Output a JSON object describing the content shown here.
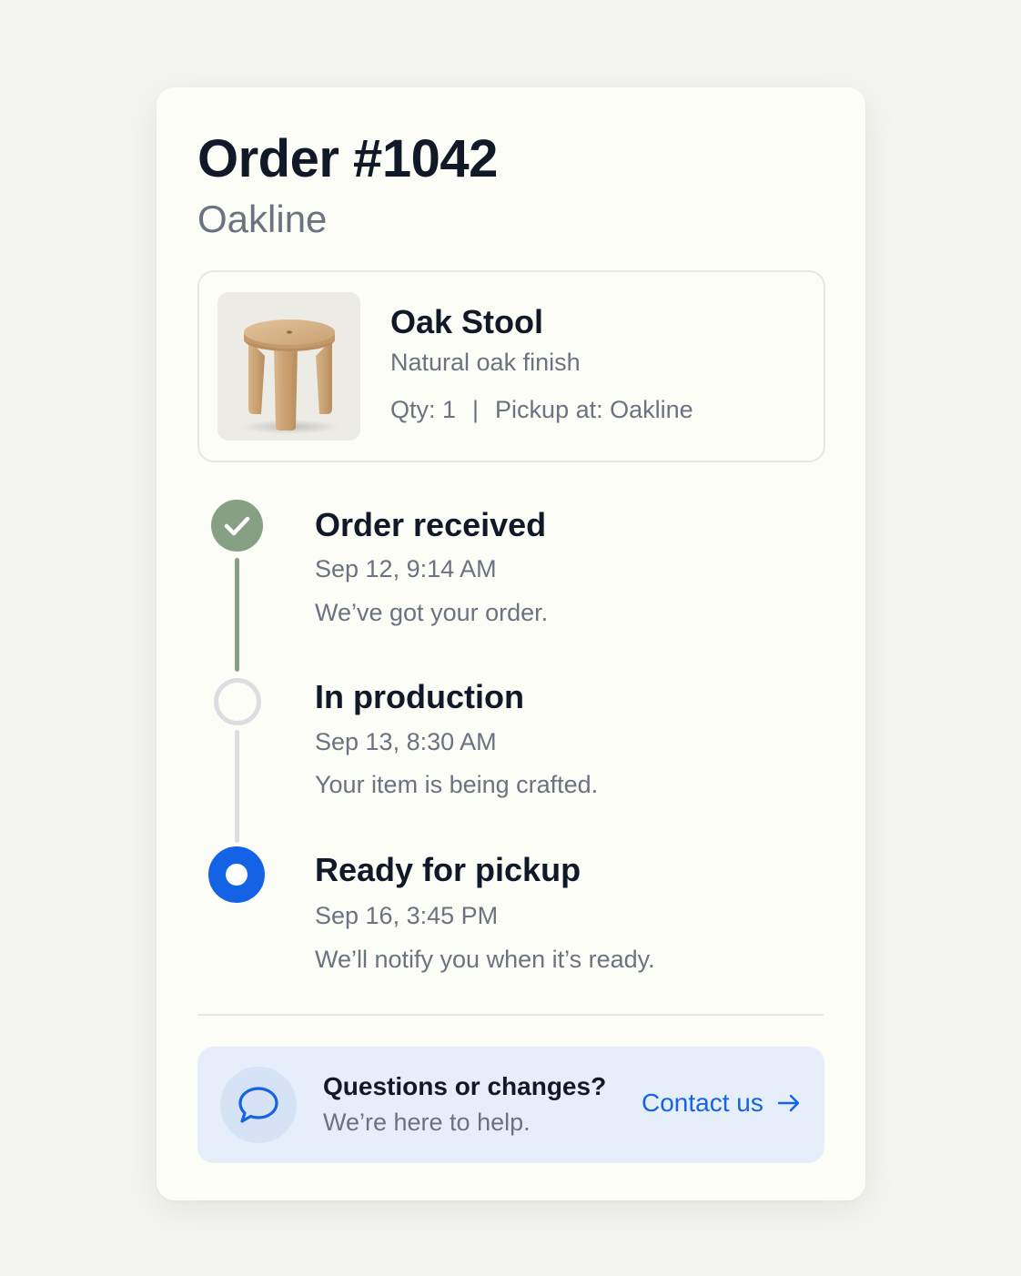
{
  "order": {
    "title": "Order #1042",
    "store": "Oakline"
  },
  "product": {
    "name": "Oak Stool",
    "finish": "Natural oak finish",
    "qty": "Qty: 1",
    "separator": "|",
    "pickup": "Pickup at: Oakline",
    "image_icon": "oak-stool-photo"
  },
  "timeline": [
    {
      "title": "Order received",
      "time": "Sep 12, 9:14 AM",
      "description": "We’ve got your order.",
      "status": "completed"
    },
    {
      "title": "In production",
      "time": "Sep 13, 8:30 AM",
      "description": "Your item is being crafted.",
      "status": "pending"
    },
    {
      "title": "Ready for pickup",
      "time": "Sep 16, 3:45 PM",
      "description": "We’ll notify you when it’s ready.",
      "status": "current"
    }
  ],
  "help": {
    "title": "Questions or changes?",
    "subtitle": "We’re here to help.",
    "contact_label": "Contact us",
    "icon": "chat-bubble-icon",
    "link_icon": "arrow-right-icon"
  },
  "colors": {
    "accent": "#1463e6",
    "completed": "#86a083",
    "pending": "#dcdde0"
  }
}
